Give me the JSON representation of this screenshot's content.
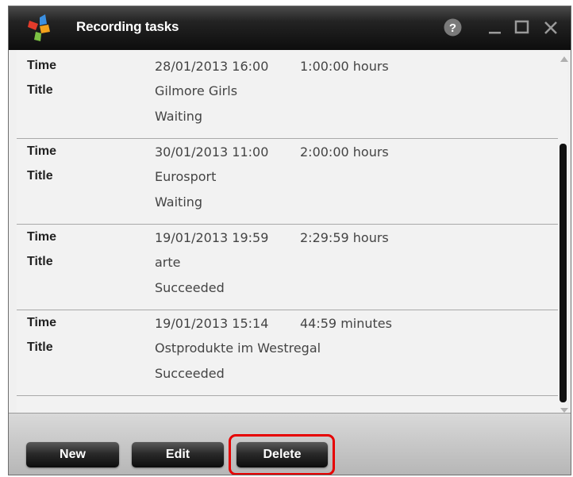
{
  "window": {
    "title": "Recording tasks"
  },
  "labels": {
    "time": "Time",
    "title": "Title"
  },
  "tasks": [
    {
      "datetime": "28/01/2013 16:00",
      "duration": "1:00:00 hours",
      "title": "Gilmore Girls",
      "status": "Waiting"
    },
    {
      "datetime": "30/01/2013 11:00",
      "duration": "2:00:00 hours",
      "title": "Eurosport",
      "status": "Waiting"
    },
    {
      "datetime": "19/01/2013 19:59",
      "duration": "2:29:59 hours",
      "title": "arte",
      "status": "Succeeded"
    },
    {
      "datetime": "19/01/2013 15:14",
      "duration": "44:59 minutes",
      "title": "Ostprodukte im Westregal",
      "status": "Succeeded"
    }
  ],
  "buttons": {
    "new": "New",
    "edit": "Edit",
    "delete": "Delete"
  },
  "icons": {
    "help": "help-icon",
    "minimize": "minimize-icon",
    "maximize": "maximize-icon",
    "close": "close-icon",
    "logo": "app-logo"
  },
  "colors": {
    "titlebar": "#111111",
    "highlight": "#e60000",
    "button": "#1e1e1e"
  }
}
